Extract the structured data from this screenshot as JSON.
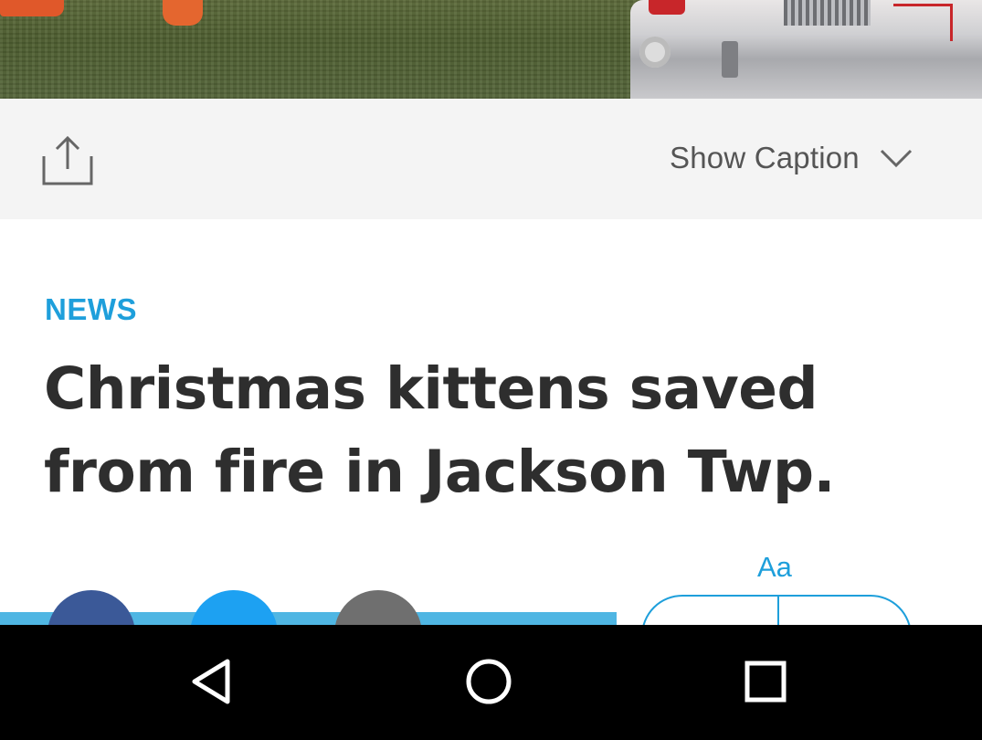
{
  "photo": {
    "subject": "fire-truck-on-grass"
  },
  "caption_bar": {
    "share_icon": "share-icon",
    "toggle_label": "Show Caption",
    "toggle_icon": "chevron-down-icon"
  },
  "article": {
    "section": "NEWS",
    "headline": "Christmas kittens saved from fire in Jackson Twp."
  },
  "toolbar": {
    "font_size_label": "Aa",
    "social": [
      {
        "icon": "facebook-icon",
        "color": "#3b5998"
      },
      {
        "icon": "twitter-icon",
        "color": "#1da1f2"
      },
      {
        "icon": "email-icon",
        "color": "#6f6f6f"
      }
    ]
  },
  "system_nav": {
    "back_icon": "back-triangle-icon",
    "home_icon": "home-circle-icon",
    "recents_icon": "recents-square-icon"
  },
  "colors": {
    "accent": "#1e9fdb",
    "headline": "#2e2e2e",
    "caption_bg": "#f4f4f4",
    "navbar_bg": "#000000"
  }
}
